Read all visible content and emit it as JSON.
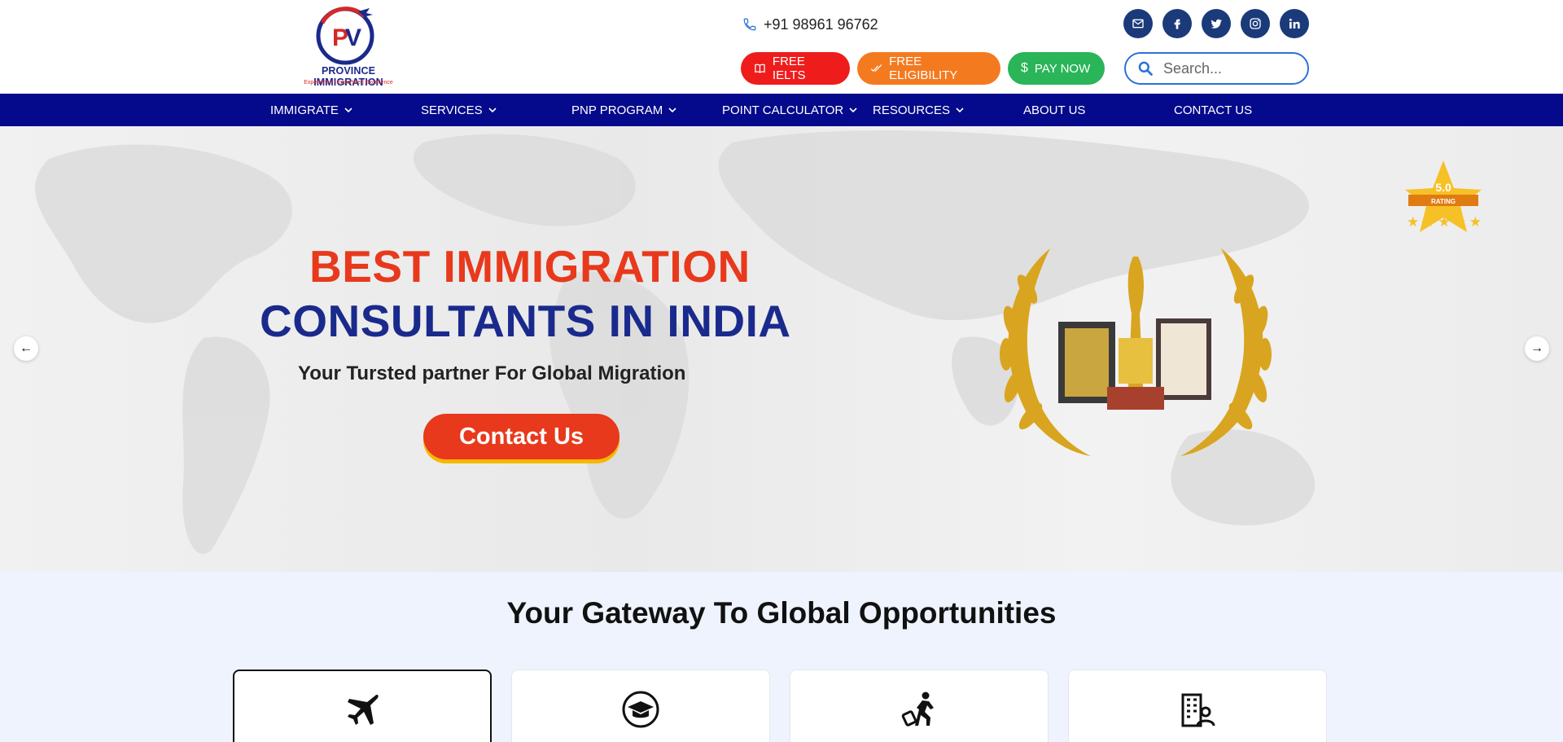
{
  "header": {
    "logo": {
      "name": "PROVINCE IMMIGRATION",
      "tagline": "Experience | Expertise | Excellence"
    },
    "phone": "+91 98961 96762",
    "socials": [
      "email-icon",
      "facebook-icon",
      "twitter-icon",
      "instagram-icon",
      "linkedin-icon"
    ],
    "buttons": {
      "free_ielts": "FREE IELTS",
      "free_eligibility": "FREE ELIGIBILITY",
      "pay_now": "PAY NOW"
    },
    "search": {
      "placeholder": "Search..."
    }
  },
  "nav": {
    "items": [
      {
        "label": "IMMIGRATE",
        "dropdown": true
      },
      {
        "label": "SERVICES",
        "dropdown": true
      },
      {
        "label": "PNP PROGRAM",
        "dropdown": true
      },
      {
        "label": "POINT CALCULATOR",
        "dropdown": true
      },
      {
        "label": "RESOURCES",
        "dropdown": true
      },
      {
        "label": "ABOUT US",
        "dropdown": false
      },
      {
        "label": "CONTACT US",
        "dropdown": false
      }
    ]
  },
  "hero": {
    "headline_1": "BEST IMMIGRATION",
    "headline_2": "CONSULTANTS IN INDIA",
    "subtitle": "Your Tursted partner For Global Migration",
    "cta": "Contact Us",
    "rating": {
      "value": "5.0",
      "label": "RATING",
      "stars": 5
    },
    "colors": {
      "accent_red": "#e8391c",
      "navy": "#1a2a8c"
    }
  },
  "section": {
    "title": "Your Gateway To Global Opportunities",
    "cards": [
      {
        "icon": "airplane-icon"
      },
      {
        "icon": "graduation-cap-icon"
      },
      {
        "icon": "traveler-icon"
      },
      {
        "icon": "business-building-icon"
      }
    ]
  }
}
